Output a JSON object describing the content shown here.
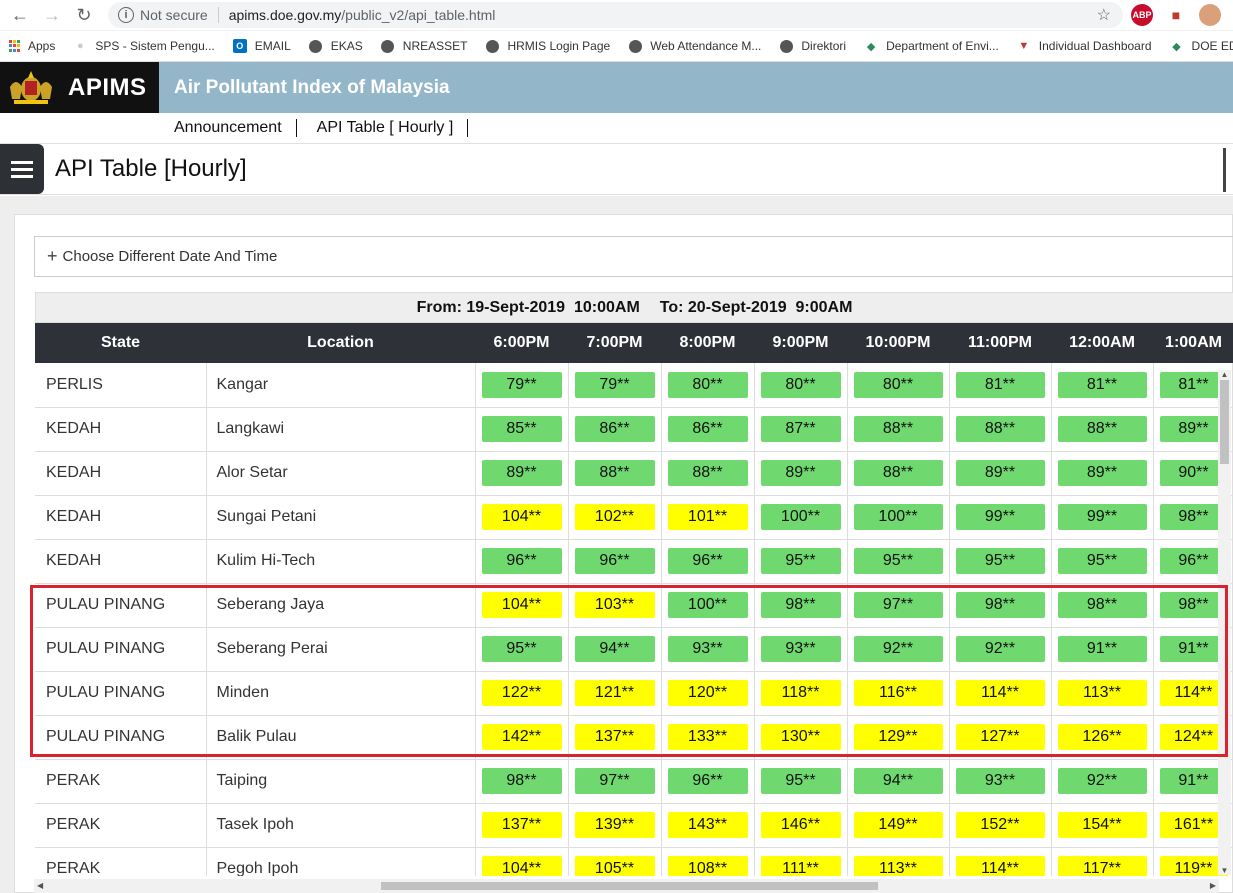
{
  "browser": {
    "security_label": "Not secure",
    "url_host": "apims.doe.gov.my",
    "url_path": "/public_v2/api_table.html"
  },
  "bookmarks": [
    {
      "label": "Apps",
      "icon": "apps-grid-icon"
    },
    {
      "label": "SPS - Sistem Pengu...",
      "icon": "page-icon"
    },
    {
      "label": "EMAIL",
      "icon": "outlook-icon"
    },
    {
      "label": "EKAS",
      "icon": "globe-icon"
    },
    {
      "label": "NREASSET",
      "icon": "globe-icon"
    },
    {
      "label": "HRMIS Login Page",
      "icon": "globe-icon"
    },
    {
      "label": "Web Attendance M...",
      "icon": "globe-icon"
    },
    {
      "label": "Direktori",
      "icon": "globe-icon"
    },
    {
      "label": "Department of Envi...",
      "icon": "doe-icon"
    },
    {
      "label": "Individual Dashboard",
      "icon": "dashboard-icon"
    },
    {
      "label": "DOE EDC",
      "icon": "doe-icon"
    }
  ],
  "header": {
    "brand": "APIMS",
    "title": "Air Pollutant Index of Malaysia"
  },
  "subnav": [
    "Announcement",
    "API Table [ Hourly ]"
  ],
  "page": {
    "title": "API Table [Hourly]",
    "chooser_label": "Choose Different Date And Time",
    "range_from": "From: 19-Sept-2019  10:00AM",
    "range_to": "To: 20-Sept-2019  9:00AM"
  },
  "table": {
    "headers": [
      "State",
      "Location",
      "6:00PM",
      "7:00PM",
      "8:00PM",
      "9:00PM",
      "10:00PM",
      "11:00PM",
      "12:00AM",
      "1:00AM"
    ],
    "rows": [
      {
        "state": "PERLIS",
        "location": "Kangar",
        "values": [
          "79**",
          "79**",
          "80**",
          "80**",
          "80**",
          "81**",
          "81**",
          "81**"
        ]
      },
      {
        "state": "KEDAH",
        "location": "Langkawi",
        "values": [
          "85**",
          "86**",
          "86**",
          "87**",
          "88**",
          "88**",
          "88**",
          "89**"
        ]
      },
      {
        "state": "KEDAH",
        "location": "Alor Setar",
        "values": [
          "89**",
          "88**",
          "88**",
          "89**",
          "88**",
          "89**",
          "89**",
          "90**"
        ]
      },
      {
        "state": "KEDAH",
        "location": "Sungai Petani",
        "values": [
          "104**",
          "102**",
          "101**",
          "100**",
          "100**",
          "99**",
          "99**",
          "98**"
        ]
      },
      {
        "state": "KEDAH",
        "location": "Kulim Hi-Tech",
        "values": [
          "96**",
          "96**",
          "96**",
          "95**",
          "95**",
          "95**",
          "95**",
          "96**"
        ]
      },
      {
        "state": "PULAU PINANG",
        "location": "Seberang Jaya",
        "values": [
          "104**",
          "103**",
          "100**",
          "98**",
          "97**",
          "98**",
          "98**",
          "98**"
        ]
      },
      {
        "state": "PULAU PINANG",
        "location": "Seberang Perai",
        "values": [
          "95**",
          "94**",
          "93**",
          "93**",
          "92**",
          "92**",
          "91**",
          "91**"
        ]
      },
      {
        "state": "PULAU PINANG",
        "location": "Minden",
        "values": [
          "122**",
          "121**",
          "120**",
          "118**",
          "116**",
          "114**",
          "113**",
          "114**"
        ]
      },
      {
        "state": "PULAU PINANG",
        "location": "Balik Pulau",
        "values": [
          "142**",
          "137**",
          "133**",
          "130**",
          "129**",
          "127**",
          "126**",
          "124**"
        ]
      },
      {
        "state": "PERAK",
        "location": "Taiping",
        "values": [
          "98**",
          "97**",
          "96**",
          "95**",
          "94**",
          "93**",
          "92**",
          "91**"
        ]
      },
      {
        "state": "PERAK",
        "location": "Tasek Ipoh",
        "values": [
          "137**",
          "139**",
          "143**",
          "146**",
          "149**",
          "152**",
          "154**",
          "161**"
        ]
      },
      {
        "state": "PERAK",
        "location": "Pegoh Ipoh",
        "values": [
          "104**",
          "105**",
          "108**",
          "111**",
          "113**",
          "114**",
          "117**",
          "119**"
        ]
      }
    ]
  },
  "colors": {
    "good": "#6fd96f",
    "moderate": "#ffff00",
    "highlight_border": "#d9232e"
  }
}
